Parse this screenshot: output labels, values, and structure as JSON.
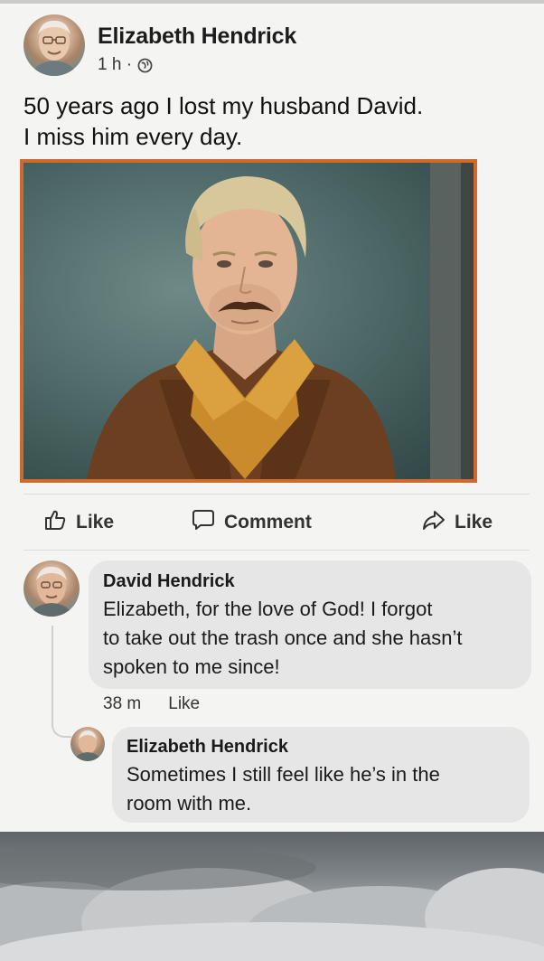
{
  "post": {
    "author": "Elizabeth Hendrick",
    "time": "1 h ·",
    "privacy_icon": "globe-icon",
    "text_lines": [
      "50 years ago I lost my husband David.",
      "I miss him every day."
    ]
  },
  "actions": {
    "like": "Like",
    "comment": "Comment",
    "share": "Like"
  },
  "comments": [
    {
      "author": "David Hendrick",
      "text_lines": [
        "Elizabeth, for the love of God! I forgot",
        "to take out the trash once and she hasn’t",
        "spoken to me since!"
      ],
      "time": "38 m",
      "like_label": "Like"
    },
    {
      "author": "Elizabeth Hendrick",
      "text_lines": [
        "Sometimes I still feel like he’s in the",
        "room with me."
      ]
    }
  ],
  "colors": {
    "photo_border": "#d06a2c",
    "bubble": "#e6e6e6",
    "background": "#f4f4f2"
  }
}
